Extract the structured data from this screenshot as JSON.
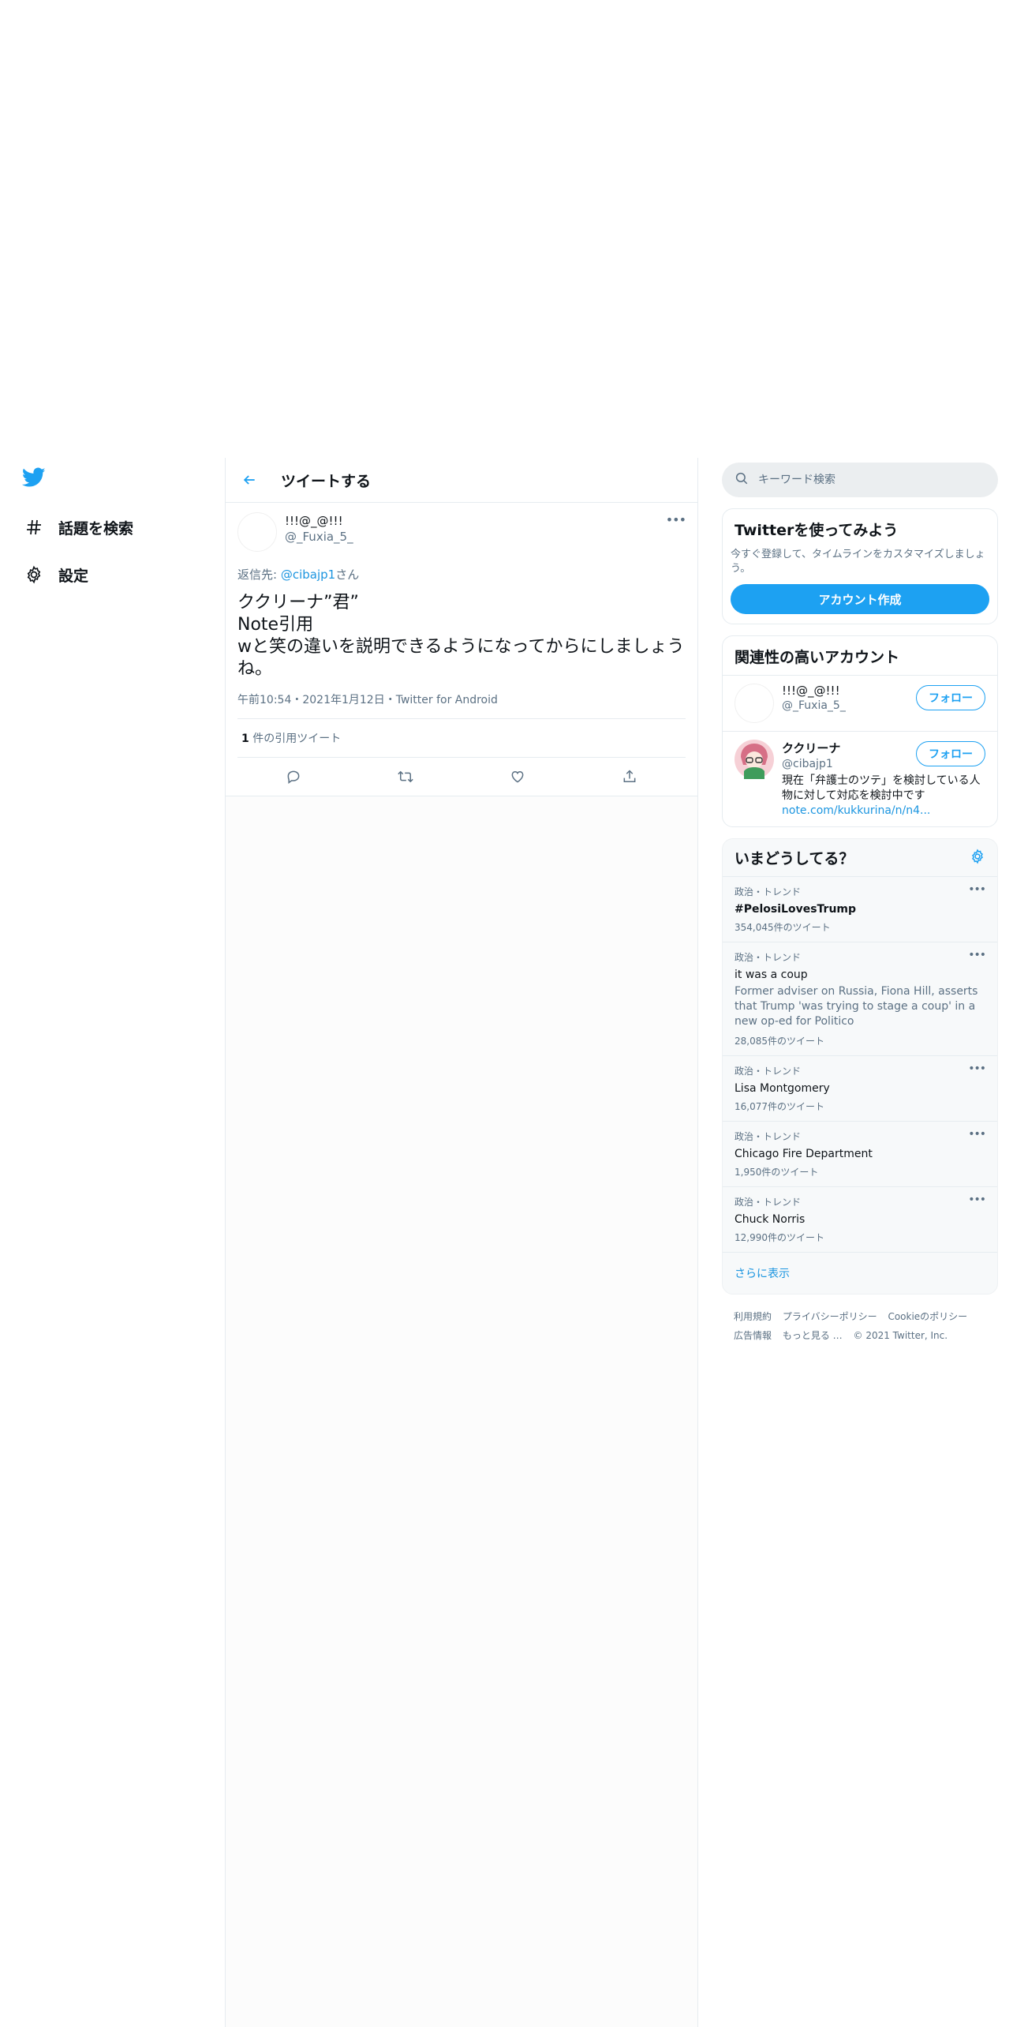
{
  "nav": {
    "items": [
      {
        "label": "話題を検索",
        "icon": "hashtag-icon"
      },
      {
        "label": "設定",
        "icon": "gear-icon"
      }
    ]
  },
  "header": {
    "title": "ツイートする"
  },
  "tweet": {
    "author_name": "!!!@_@!!!",
    "author_handle": "@_Fuxia_5_",
    "reply_prefix": "返信先: ",
    "reply_to": "@cibajp1",
    "reply_suffix": "さん",
    "text": "ククリーナ”君”\nNote引用\nwと笑の違いを説明できるようになってからにしましょうね。",
    "time": "午前10:54・2021年1月12日・",
    "app": "Twitter for Android",
    "quote_count": "1",
    "quote_label": " 件の引用ツイート"
  },
  "search": {
    "placeholder": "キーワード検索"
  },
  "signup": {
    "title": "Twitterを使ってみよう",
    "desc": "今すぐ登録して、タイムラインをカスタマイズしましょう。",
    "button": "アカウント作成"
  },
  "relevant": {
    "title": "関連性の高いアカウント",
    "follow_label": "フォロー",
    "accounts": [
      {
        "name": "!!!@_@!!!",
        "handle": "@_Fuxia_5_"
      },
      {
        "name": "ククリーナ",
        "handle": "@cibajp1",
        "bio": "現在「弁護士のツテ」を検討している人物に対して対応を検討中です",
        "link": "note.com/kukkurina/n/n4..."
      }
    ]
  },
  "trends": {
    "title": "いまどうしてる？",
    "items": [
      {
        "context": "政治・トレンド",
        "name": "#PelosiLovesTrump",
        "count": "354,045件のツイート"
      },
      {
        "context": "政治・トレンド",
        "name": "it was a coup",
        "desc": "Former adviser on Russia, Fiona Hill, asserts that Trump 'was trying to stage a coup' in a new op-ed for Politico",
        "count": "28,085件のツイート"
      },
      {
        "context": "政治・トレンド",
        "name": "Lisa Montgomery",
        "count": "16,077件のツイート"
      },
      {
        "context": "政治・トレンド",
        "name": "Chicago Fire Department",
        "count": "1,950件のツイート"
      },
      {
        "context": "政治・トレンド",
        "name": "Chuck Norris",
        "count": "12,990件のツイート"
      }
    ],
    "show_more": "さらに表示"
  },
  "footer": {
    "links": [
      "利用規約",
      "プライバシーポリシー",
      "Cookieのポリシー",
      "広告情報",
      "もっと見る …"
    ],
    "copyright": "© 2021 Twitter, Inc."
  },
  "colors": {
    "accent": "#1da1f2",
    "link": "#1b95e0",
    "muted": "#5b7083"
  }
}
